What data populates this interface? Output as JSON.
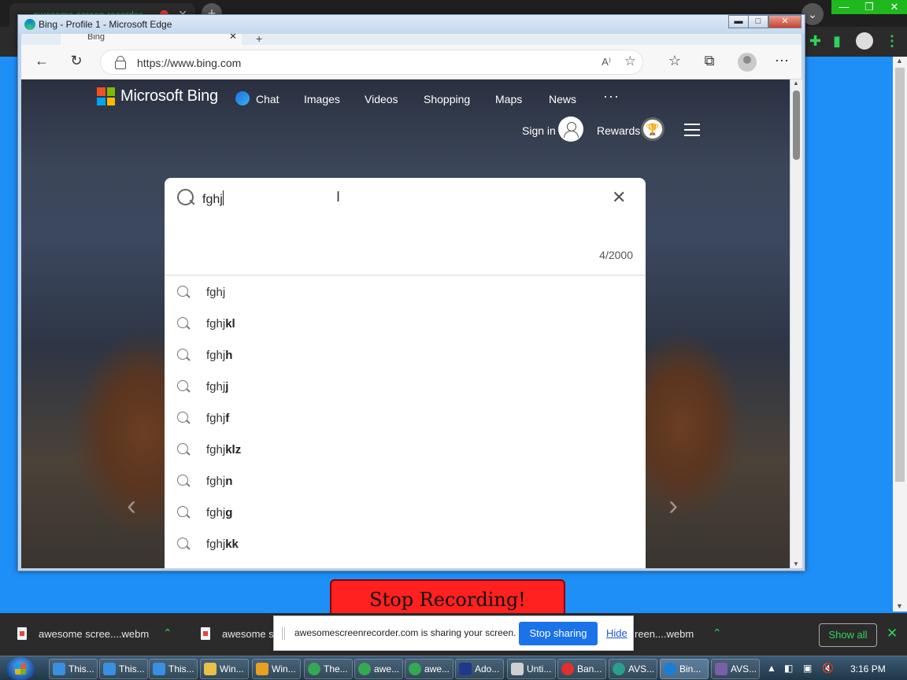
{
  "outer_browser": {
    "tab_title": "awesome screen recorder",
    "tab_close": "✕",
    "new_tab": "+",
    "chevron": "⌄",
    "window_buttons": [
      "—",
      "❐",
      "✕"
    ],
    "kebab": "⋮"
  },
  "edge": {
    "window_title": "Bing - Profile 1 - Microsoft Edge",
    "window_buttons": {
      "minimize": "▬",
      "maximize": "□",
      "close": "✕"
    },
    "tab_title": "Bing",
    "tab_close": "✕",
    "tab_new": "+",
    "nav": {
      "back": "←",
      "refresh": "↻",
      "favorites": "☆",
      "collections": "⧉",
      "more": "⋯"
    },
    "url": "https://www.bing.com",
    "read_aloud": "A⁾",
    "add_favorite": "☆"
  },
  "bing": {
    "brand": "Microsoft Bing",
    "logo_colors": [
      "#f25022",
      "#7fba00",
      "#00a4ef",
      "#ffb900"
    ],
    "nav": [
      {
        "label": "Chat"
      },
      {
        "label": "Images"
      },
      {
        "label": "Videos"
      },
      {
        "label": "Shopping"
      },
      {
        "label": "Maps"
      },
      {
        "label": "News"
      }
    ],
    "more_dots": "···",
    "sign_in": "Sign in",
    "rewards": "Rewards",
    "rewards_icon": "🏆",
    "carousel_prev": "‹",
    "carousel_next": "›",
    "search": {
      "query": "fghj",
      "clear": "✕",
      "ibeam": "I",
      "char_count": "4/2000"
    },
    "suggestions": [
      {
        "prefix": "fghj",
        "suffix": ""
      },
      {
        "prefix": "fghj",
        "suffix": "kl"
      },
      {
        "prefix": "fghj",
        "suffix": "h"
      },
      {
        "prefix": "fghj",
        "suffix": "j"
      },
      {
        "prefix": "fghj",
        "suffix": "f"
      },
      {
        "prefix": "fghj",
        "suffix": "klz"
      },
      {
        "prefix": "fghj",
        "suffix": "n"
      },
      {
        "prefix": "fghj",
        "suffix": "g"
      },
      {
        "prefix": "fghj",
        "suffix": "kk"
      }
    ]
  },
  "stop_recording": "Stop Recording!",
  "downloads": {
    "items": [
      "awesome scree....webm",
      "awesome sc",
      "reen....webm"
    ],
    "show_all": "Show all",
    "close": "✕",
    "chevron": "⌃"
  },
  "share_popup": {
    "message": "awesomescreenrecorder.com is sharing your screen.",
    "stop": "Stop sharing",
    "hide": "Hide"
  },
  "taskbar": {
    "items": [
      {
        "label": "This...",
        "icon_color": "#3b8fe0"
      },
      {
        "label": "This...",
        "icon_color": "#3b8fe0"
      },
      {
        "label": "This...",
        "icon_color": "#3b8fe0"
      },
      {
        "label": "Win...",
        "icon_color": "#e8c04a"
      },
      {
        "label": "Win...",
        "icon_color": "#e8a020"
      },
      {
        "label": "The...",
        "icon_color": "#34a853"
      },
      {
        "label": "awe...",
        "icon_color": "#34a853"
      },
      {
        "label": "awe...",
        "icon_color": "#34a853"
      },
      {
        "label": "Ado...",
        "icon_color": "#1f3a8a"
      },
      {
        "label": "Unti...",
        "icon_color": "#d0d0d0"
      },
      {
        "label": "Ban...",
        "icon_color": "#e03030"
      },
      {
        "label": "AVS...",
        "icon_color": "#2a9d8f"
      },
      {
        "label": "Bin...",
        "icon_color": "#1a7fd4"
      },
      {
        "label": "AVS...",
        "icon_color": "#7a5ea8"
      }
    ],
    "time": "3:16 PM"
  }
}
